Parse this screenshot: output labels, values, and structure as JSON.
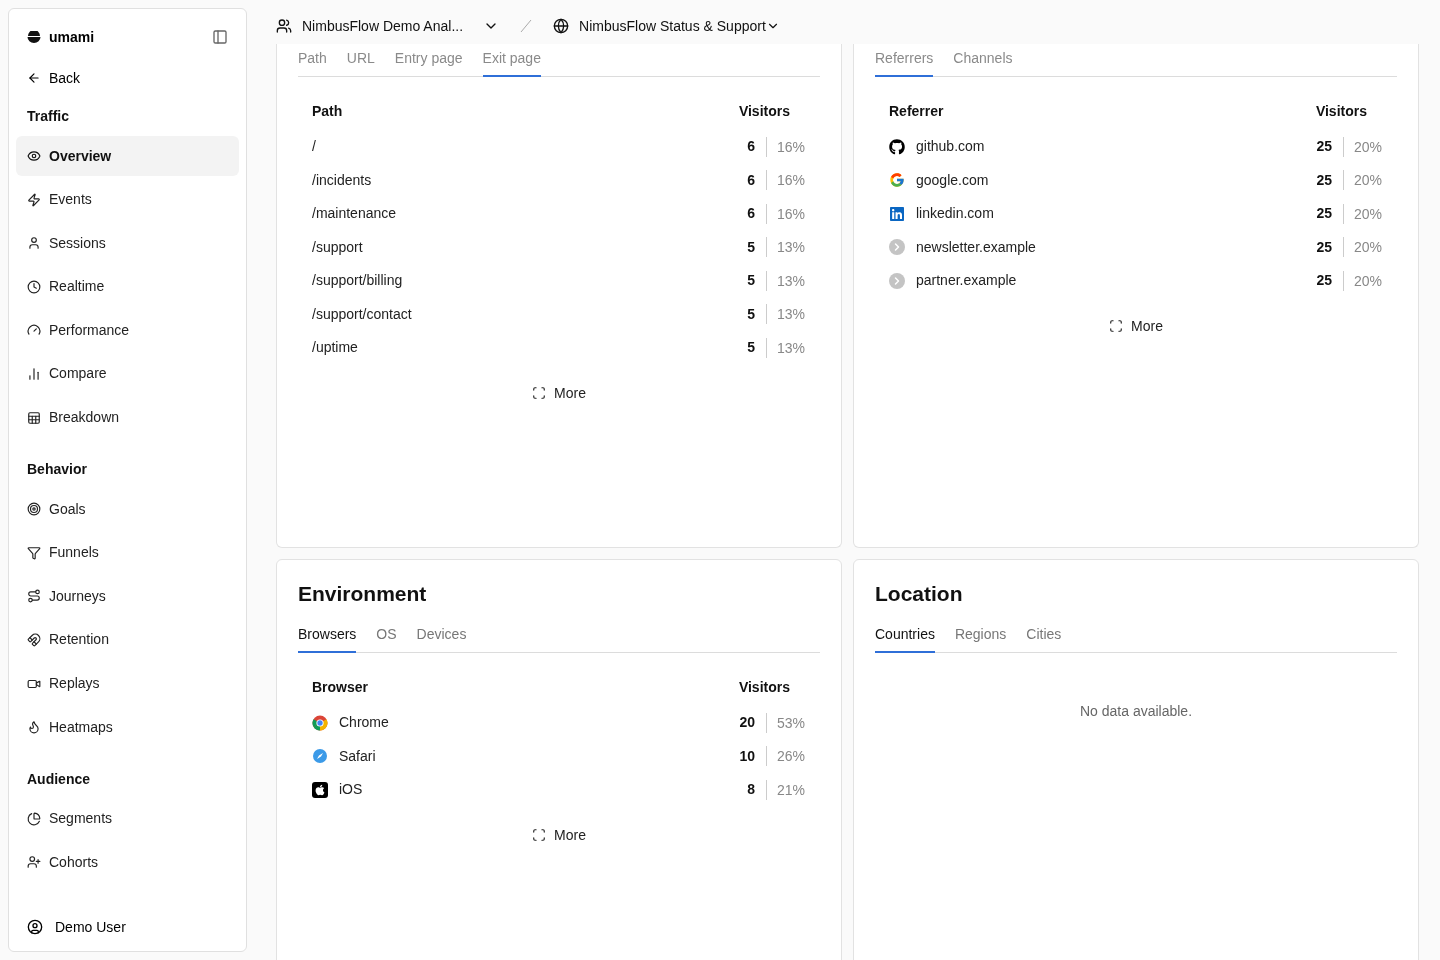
{
  "sidebar": {
    "brand": "umami",
    "back": "Back",
    "groups": [
      {
        "heading": "Traffic",
        "items": [
          {
            "label": "Overview",
            "selected": true
          },
          {
            "label": "Events",
            "selected": false
          },
          {
            "label": "Sessions",
            "selected": false
          },
          {
            "label": "Realtime",
            "selected": false
          },
          {
            "label": "Performance",
            "selected": false
          },
          {
            "label": "Compare",
            "selected": false
          },
          {
            "label": "Breakdown",
            "selected": false
          }
        ]
      },
      {
        "heading": "Behavior",
        "items": [
          {
            "label": "Goals",
            "selected": false
          },
          {
            "label": "Funnels",
            "selected": false
          },
          {
            "label": "Journeys",
            "selected": false
          },
          {
            "label": "Retention",
            "selected": false
          },
          {
            "label": "Replays",
            "selected": false
          },
          {
            "label": "Heatmaps",
            "selected": false
          }
        ]
      },
      {
        "heading": "Audience",
        "items": [
          {
            "label": "Segments",
            "selected": false
          },
          {
            "label": "Cohorts",
            "selected": false
          }
        ]
      }
    ],
    "user": "Demo User"
  },
  "header": {
    "team": "NimbusFlow Demo Anal...",
    "website": "NimbusFlow Status & Support"
  },
  "panels": [
    {
      "kind": "pages",
      "tabs": [
        {
          "label": "Path",
          "selected": false
        },
        {
          "label": "URL",
          "selected": false
        },
        {
          "label": "Entry page",
          "selected": false
        },
        {
          "label": "Exit page",
          "selected": true
        }
      ],
      "columns": [
        "Path",
        "Visitors"
      ],
      "rows": [
        {
          "label": "/",
          "count": "6",
          "percent": "16%"
        },
        {
          "label": "/incidents",
          "count": "6",
          "percent": "16%"
        },
        {
          "label": "/maintenance",
          "count": "6",
          "percent": "16%"
        },
        {
          "label": "/support",
          "count": "5",
          "percent": "13%"
        },
        {
          "label": "/support/billing",
          "count": "5",
          "percent": "13%"
        },
        {
          "label": "/support/contact",
          "count": "5",
          "percent": "13%"
        },
        {
          "label": "/uptime",
          "count": "5",
          "percent": "13%"
        }
      ],
      "more": "More"
    },
    {
      "kind": "referrers",
      "tabs": [
        {
          "label": "Referrers",
          "selected": true
        },
        {
          "label": "Channels",
          "selected": false
        }
      ],
      "columns": [
        "Referrer",
        "Visitors"
      ],
      "rows": [
        {
          "label": "github.com",
          "count": "25",
          "percent": "20%"
        },
        {
          "label": "google.com",
          "count": "25",
          "percent": "20%"
        },
        {
          "label": "linkedin.com",
          "count": "25",
          "percent": "20%"
        },
        {
          "label": "newsletter.example",
          "count": "25",
          "percent": "20%"
        },
        {
          "label": "partner.example",
          "count": "25",
          "percent": "20%"
        }
      ],
      "more": "More"
    },
    {
      "kind": "browsers",
      "title": "Environment",
      "tabs": [
        {
          "label": "Browsers",
          "selected": true
        },
        {
          "label": "OS",
          "selected": false
        },
        {
          "label": "Devices",
          "selected": false
        }
      ],
      "columns": [
        "Browser",
        "Visitors"
      ],
      "rows": [
        {
          "label": "Chrome",
          "count": "20",
          "percent": "53%"
        },
        {
          "label": "Safari",
          "count": "10",
          "percent": "26%"
        },
        {
          "label": "iOS",
          "count": "8",
          "percent": "21%"
        }
      ],
      "more": "More"
    },
    {
      "title": "Location",
      "tabs": [
        {
          "label": "Countries",
          "selected": true
        },
        {
          "label": "Regions",
          "selected": false
        },
        {
          "label": "Cities",
          "selected": false
        }
      ],
      "empty": "No data available."
    }
  ]
}
